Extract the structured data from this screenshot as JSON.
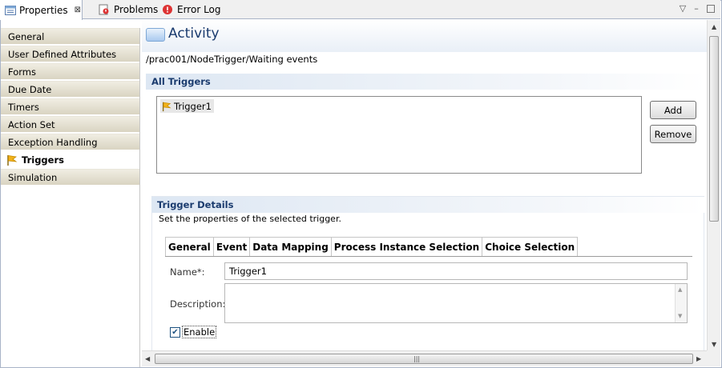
{
  "tabs": [
    {
      "label": "Properties",
      "icon": "properties-icon",
      "active": true
    },
    {
      "label": "Problems",
      "icon": "problems-icon",
      "active": false
    },
    {
      "label": "Error Log",
      "icon": "error-log-icon",
      "active": false
    }
  ],
  "tab_close_glyph": "⊠",
  "window_controls": {
    "menu": "▽",
    "minimize": "–"
  },
  "nav": {
    "items": [
      {
        "label": "General"
      },
      {
        "label": "User Defined Attributes"
      },
      {
        "label": "Forms"
      },
      {
        "label": "Due Date"
      },
      {
        "label": "Timers"
      },
      {
        "label": "Action Set"
      },
      {
        "label": "Exception Handling"
      },
      {
        "label": "Triggers",
        "selected": true
      },
      {
        "label": "Simulation"
      }
    ]
  },
  "main": {
    "title": "Activity",
    "breadcrumb": "/prac001/NodeTrigger/Waiting events",
    "all_triggers": {
      "heading": "All Triggers",
      "items": [
        "Trigger1"
      ],
      "add_label": "Add",
      "remove_label": "Remove"
    },
    "trigger_details": {
      "heading": "Trigger Details",
      "description": "Set the properties of the selected trigger.",
      "tabs": [
        "General",
        "Event",
        "Data Mapping",
        "Process Instance Selection",
        "Choice Selection"
      ],
      "active_tab": "General",
      "name_label": "Name*:",
      "name_value": "Trigger1",
      "description_label": "Description:",
      "description_value": "",
      "enable_label": "Enable",
      "enable_checked": true,
      "check_glyph": "✔"
    }
  },
  "colors": {
    "title": "#1a3b6e",
    "nav_bg_top": "#f0ede2",
    "nav_bg_bottom": "#d9d4c2",
    "flag": "#e8a100"
  }
}
